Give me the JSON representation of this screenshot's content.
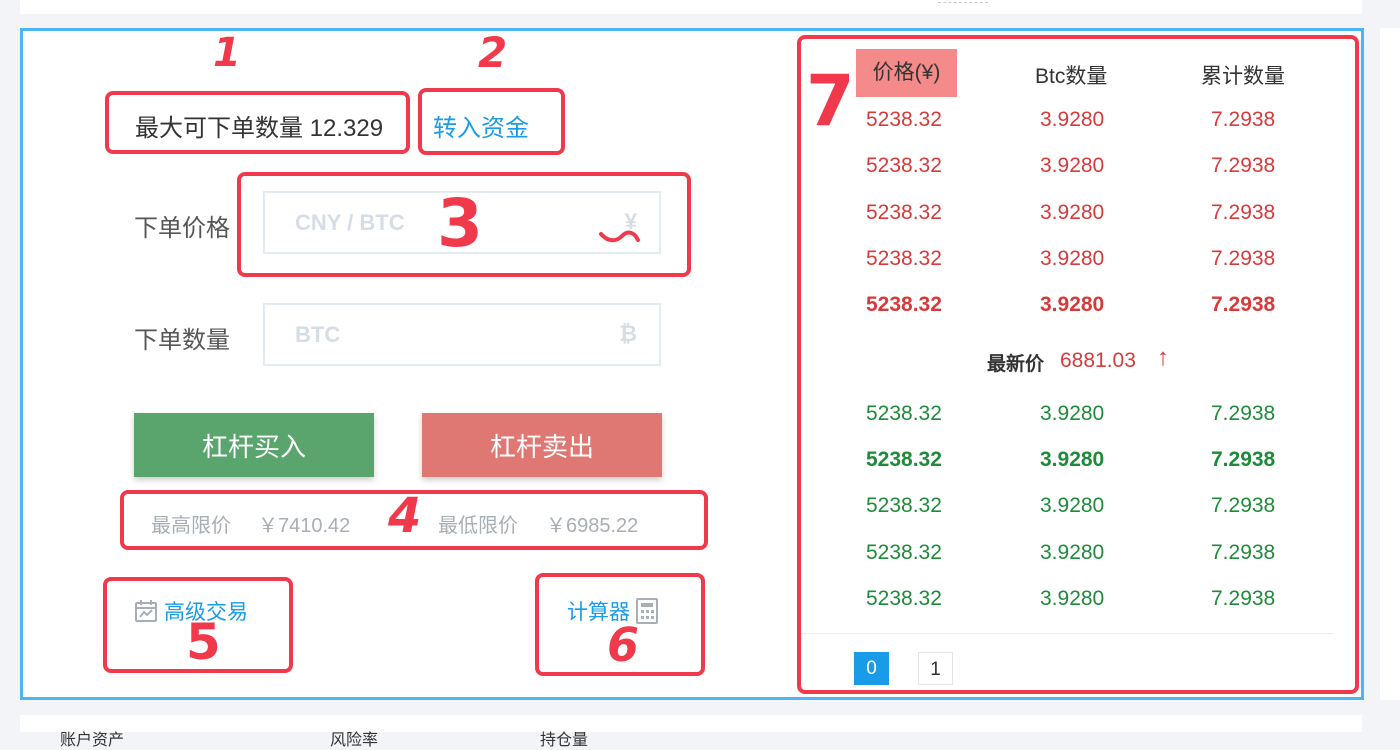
{
  "annotations": [
    "1",
    "2",
    "3",
    "4",
    "5",
    "6",
    "7"
  ],
  "order_form": {
    "max_qty_label": "最大可下单数量 12.329",
    "transfer_link": "转入资金",
    "price_label": "下单价格",
    "price_placeholder": "CNY / BTC",
    "price_unit": "¥",
    "qty_label": "下单数量",
    "qty_placeholder": "BTC",
    "qty_unit": "₿",
    "buy_button": "杠杆买入",
    "sell_button": "杠杆卖出",
    "max_limit_label": "最高限价",
    "max_limit_value": "￥7410.42",
    "min_limit_label": "最低限价",
    "min_limit_value": "￥6985.22",
    "advanced_link": "高级交易",
    "calculator_link": "计算器"
  },
  "order_book": {
    "headers": [
      "价格(¥)",
      "Btc数量",
      "累计数量"
    ],
    "asks": [
      [
        "5238.32",
        "3.9280",
        "7.2938"
      ],
      [
        "5238.32",
        "3.9280",
        "7.2938"
      ],
      [
        "5238.32",
        "3.9280",
        "7.2938"
      ],
      [
        "5238.32",
        "3.9280",
        "7.2938"
      ],
      [
        "5238.32",
        "3.9280",
        "7.2938"
      ]
    ],
    "latest_label": "最新价",
    "latest_value": "6881.03",
    "latest_arrow": "↑",
    "bids": [
      [
        "5238.32",
        "3.9280",
        "7.2938"
      ],
      [
        "5238.32",
        "3.9280",
        "7.2938"
      ],
      [
        "5238.32",
        "3.9280",
        "7.2938"
      ],
      [
        "5238.32",
        "3.9280",
        "7.2938"
      ],
      [
        "5238.32",
        "3.9280",
        "7.2938"
      ]
    ],
    "pages": [
      "0",
      "1"
    ]
  },
  "footer_text": [
    "账户资产",
    "风险率",
    "持仓量"
  ],
  "colors": {
    "accent": "#1a9be8",
    "annotation": "#f03a4c",
    "ask": "#d63a3a",
    "bid": "#1f8a3a",
    "buy": "#5aa46e",
    "sell": "#df7772"
  }
}
